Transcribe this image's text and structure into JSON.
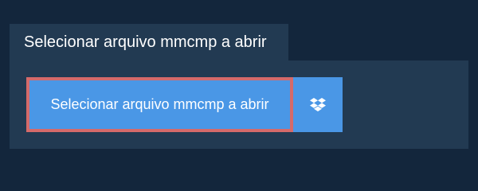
{
  "tab": {
    "label": "Selecionar arquivo mmcmp a abrir"
  },
  "upload": {
    "select_button_label": "Selecionar arquivo mmcmp a abrir",
    "dropbox_icon": "dropbox-icon"
  },
  "colors": {
    "background": "#13263c",
    "panel": "#223a52",
    "button": "#4a97e6",
    "highlight_border": "#d56a6a",
    "text": "#ffffff"
  }
}
